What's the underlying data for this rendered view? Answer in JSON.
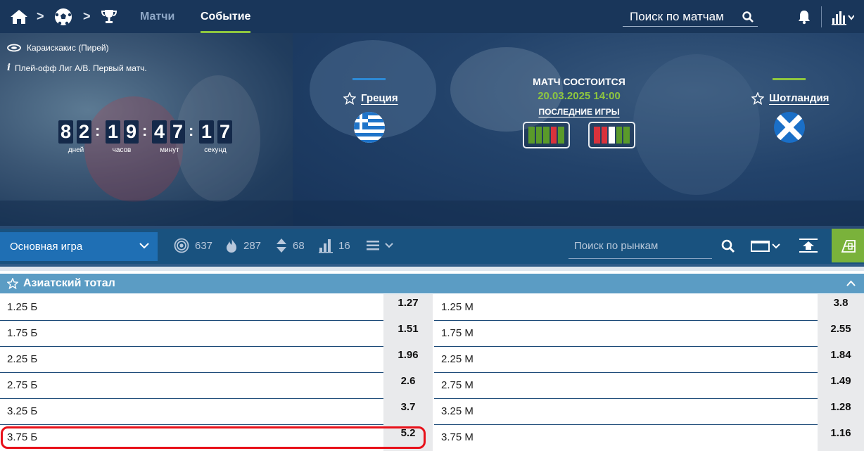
{
  "nav": {
    "tabs": [
      {
        "label": "Матчи",
        "active": false
      },
      {
        "label": "Событие",
        "active": true
      }
    ],
    "search_placeholder": "Поиск по матчам",
    "icons": [
      "home-icon",
      "soccer-ball-icon",
      "trophy-icon",
      "search-icon",
      "bell-icon",
      "stats-icon"
    ]
  },
  "event": {
    "stadium": "Караискакис (Пирей)",
    "tournament": "Плей-офф Лиг A/B. Первый матч.",
    "countdown": {
      "days": [
        "8",
        "2"
      ],
      "hours": [
        "1",
        "9"
      ],
      "minutes": [
        "4",
        "7"
      ],
      "seconds": [
        "1",
        "7"
      ],
      "labels": {
        "days": "дней",
        "hours": "часов",
        "minutes": "минут",
        "seconds": "секунд"
      }
    },
    "status": "МАТЧ СОСТОИТСЯ",
    "datetime": "20.03.2025 14:00",
    "last_games_label": "ПОСЛЕДНИЕ ИГРЫ",
    "home": {
      "name": "Греция",
      "color": "#2d8ad6"
    },
    "away": {
      "name": "Шотландия",
      "color": "#8ec63f"
    },
    "home_form": [
      "W",
      "W",
      "W",
      "L",
      "W"
    ],
    "away_form": [
      "L",
      "L",
      "D",
      "W",
      "W"
    ]
  },
  "colors": {
    "win": "#5a9a2a",
    "loss": "#d9323c",
    "draw": "#ffffff",
    "accent": "#8ec63f"
  },
  "filters": {
    "dropdown_label": "Основная игра",
    "stats": [
      {
        "icon": "target-icon",
        "count": "637"
      },
      {
        "icon": "fire-icon",
        "count": "287"
      },
      {
        "icon": "up-down-arrows-icon",
        "count": "68"
      },
      {
        "icon": "stats-bars-icon",
        "count": "16"
      }
    ],
    "market_search_placeholder": "Поиск по рынкам"
  },
  "market": {
    "title": "Азиатский тотал",
    "rows": [
      {
        "over_label": "1.25 Б",
        "over_odd": "1.27",
        "under_label": "1.25 М",
        "under_odd": "3.8"
      },
      {
        "over_label": "1.75 Б",
        "over_odd": "1.51",
        "under_label": "1.75 М",
        "under_odd": "2.55"
      },
      {
        "over_label": "2.25 Б",
        "over_odd": "1.96",
        "under_label": "2.25 М",
        "under_odd": "1.84"
      },
      {
        "over_label": "2.75 Б",
        "over_odd": "2.6",
        "under_label": "2.75 М",
        "under_odd": "1.49"
      },
      {
        "over_label": "3.25 Б",
        "over_odd": "3.7",
        "under_label": "3.25 М",
        "under_odd": "1.28"
      },
      {
        "over_label": "3.75 Б",
        "over_odd": "5.2",
        "under_label": "3.75 М",
        "under_odd": "1.16"
      }
    ]
  }
}
